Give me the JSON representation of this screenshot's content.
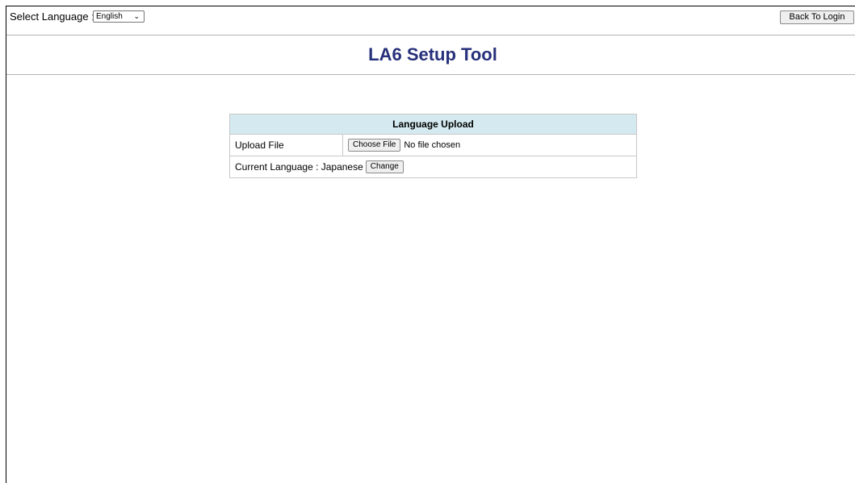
{
  "header": {
    "select_language_label": "Select Language :",
    "language_selected": "English",
    "back_button": "Back To Login"
  },
  "page": {
    "title": "LA6 Setup Tool"
  },
  "upload_panel": {
    "heading": "Language Upload",
    "upload_file_label": "Upload File",
    "choose_file_button": "Choose File",
    "file_status": "No file chosen",
    "current_language_label": "Current Language : Japanese",
    "change_button": "Change"
  }
}
